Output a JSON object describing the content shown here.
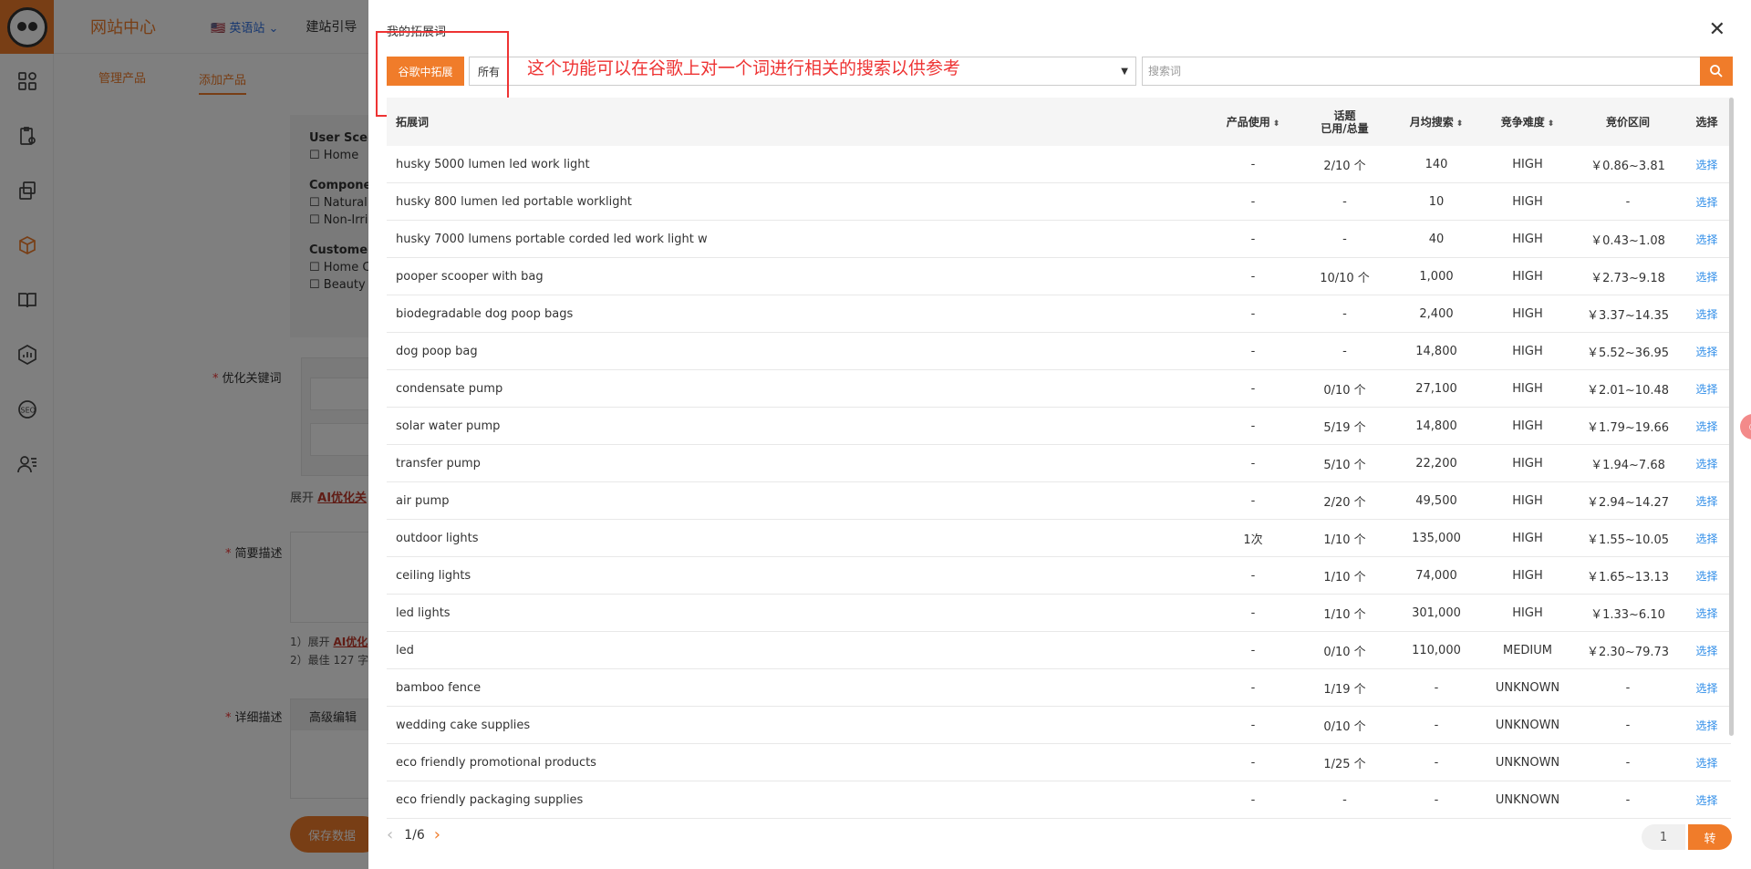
{
  "topbar": {
    "site_title": "网站中心",
    "lang": "🇺🇸 英语站 ⌄",
    "guide": "建站引导"
  },
  "subnav": {
    "manage": "管理产品",
    "add": "添加产品"
  },
  "form": {
    "user_scene": "User Scen",
    "home": "Home",
    "component": "Compone",
    "natural": "Natural",
    "nonirr": "Non-Irri",
    "customer": "Customer",
    "homec": "Home C",
    "beauty": "Beauty",
    "kw_label": "优化关键词",
    "expand_prefix": "展开",
    "ai_kw": "AI优化关",
    "brief_label": "简要描述",
    "brief_hint1": "1）展开",
    "ai_brief": "AI优化",
    "brief_hint2": "2）最佳 127 字",
    "detail_label": "详细描述",
    "adv_edit": "高级编辑",
    "save": "保存数据"
  },
  "modal": {
    "title": "我的拓展词",
    "extend_button": "谷歌中拓展",
    "select_value": "所有",
    "search_placeholder": "搜索词",
    "annotation": "这个功能可以在谷歌上对一个词进行相关的搜索以供参考",
    "columns": {
      "keyword": "拓展词",
      "product_use": "产品使用",
      "topic_line1": "话题",
      "topic_line2": "已用/总量",
      "monthly": "月均搜索",
      "competition": "竞争难度",
      "bid": "竞价区间",
      "select": "选择"
    },
    "rows": [
      {
        "keyword": "husky 5000 lumen led work light",
        "use": "-",
        "topic": "2/10 个",
        "monthly": "140",
        "comp": "HIGH",
        "bid": "￥0.86~3.81",
        "action": "选择"
      },
      {
        "keyword": "husky 800 lumen led portable worklight",
        "use": "-",
        "topic": "-",
        "monthly": "10",
        "comp": "HIGH",
        "bid": "-",
        "action": "选择"
      },
      {
        "keyword": "husky 7000 lumens portable corded led work light w",
        "use": "-",
        "topic": "-",
        "monthly": "40",
        "comp": "HIGH",
        "bid": "￥0.43~1.08",
        "action": "选择"
      },
      {
        "keyword": "pooper scooper with bag",
        "use": "-",
        "topic": "10/10 个",
        "monthly": "1,000",
        "comp": "HIGH",
        "bid": "￥2.73~9.18",
        "action": "选择"
      },
      {
        "keyword": "biodegradable dog poop bags",
        "use": "-",
        "topic": "-",
        "monthly": "2,400",
        "comp": "HIGH",
        "bid": "￥3.37~14.35",
        "action": "选择"
      },
      {
        "keyword": "dog poop bag",
        "use": "-",
        "topic": "-",
        "monthly": "14,800",
        "comp": "HIGH",
        "bid": "￥5.52~36.95",
        "action": "选择"
      },
      {
        "keyword": "condensate pump",
        "use": "-",
        "topic": "0/10 个",
        "monthly": "27,100",
        "comp": "HIGH",
        "bid": "￥2.01~10.48",
        "action": "选择"
      },
      {
        "keyword": "solar water pump",
        "use": "-",
        "topic": "5/19 个",
        "monthly": "14,800",
        "comp": "HIGH",
        "bid": "￥1.79~19.66",
        "action": "选择"
      },
      {
        "keyword": "transfer pump",
        "use": "-",
        "topic": "5/10 个",
        "monthly": "22,200",
        "comp": "HIGH",
        "bid": "￥1.94~7.68",
        "action": "选择"
      },
      {
        "keyword": "air pump",
        "use": "-",
        "topic": "2/20 个",
        "monthly": "49,500",
        "comp": "HIGH",
        "bid": "￥2.94~14.27",
        "action": "选择"
      },
      {
        "keyword": "outdoor lights",
        "use": "1次",
        "topic": "1/10 个",
        "monthly": "135,000",
        "comp": "HIGH",
        "bid": "￥1.55~10.05",
        "action": "选择"
      },
      {
        "keyword": "ceiling lights",
        "use": "-",
        "topic": "1/10 个",
        "monthly": "74,000",
        "comp": "HIGH",
        "bid": "￥1.65~13.13",
        "action": "选择"
      },
      {
        "keyword": "led lights",
        "use": "-",
        "topic": "1/10 个",
        "monthly": "301,000",
        "comp": "HIGH",
        "bid": "￥1.33~6.10",
        "action": "选择"
      },
      {
        "keyword": "led",
        "use": "-",
        "topic": "0/10 个",
        "monthly": "110,000",
        "comp": "MEDIUM",
        "bid": "￥2.30~79.73",
        "action": "选择"
      },
      {
        "keyword": "bamboo fence",
        "use": "-",
        "topic": "1/19 个",
        "monthly": "-",
        "comp": "UNKNOWN",
        "bid": "-",
        "action": "选择"
      },
      {
        "keyword": "wedding cake supplies",
        "use": "-",
        "topic": "0/10 个",
        "monthly": "-",
        "comp": "UNKNOWN",
        "bid": "-",
        "action": "选择"
      },
      {
        "keyword": "eco friendly promotional products",
        "use": "-",
        "topic": "1/25 个",
        "monthly": "-",
        "comp": "UNKNOWN",
        "bid": "-",
        "action": "选择"
      },
      {
        "keyword": "eco friendly packaging supplies",
        "use": "-",
        "topic": "-",
        "monthly": "-",
        "comp": "UNKNOWN",
        "bid": "-",
        "action": "选择"
      }
    ],
    "pager": {
      "page": "1/6",
      "jump_value": "1",
      "go": "转"
    }
  },
  "colors": {
    "accent": "#f07c2a",
    "link": "#2d8ce8",
    "annotation": "#ee3333"
  }
}
